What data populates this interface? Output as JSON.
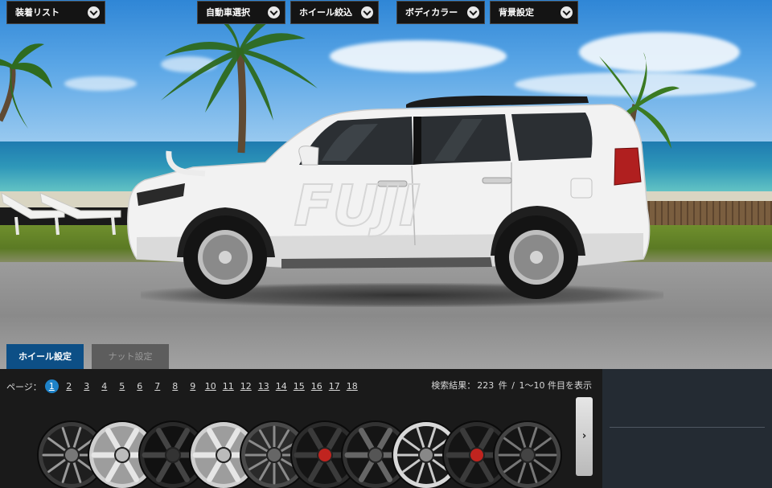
{
  "dropdowns": [
    {
      "label": "装着リスト"
    },
    {
      "label": "自動車選択"
    },
    {
      "label": "ホイール絞込"
    },
    {
      "label": "ボディカラー"
    },
    {
      "label": "背景設定"
    }
  ],
  "car": {
    "door_logo": "FUJI"
  },
  "tabs": [
    {
      "label": "ホイール設定",
      "active": true
    },
    {
      "label": "ナット設定",
      "active": false
    }
  ],
  "pager": {
    "label": "ページ：",
    "current": "1",
    "pages": [
      "2",
      "3",
      "4",
      "5",
      "6",
      "7",
      "8",
      "9",
      "10",
      "11",
      "12",
      "13",
      "14",
      "15",
      "16",
      "17",
      "18"
    ]
  },
  "result": {
    "label": "検索結果：",
    "count": "223",
    "unit": "件",
    "sep": "/",
    "range": "1〜10 件目を表示"
  },
  "wheels": [
    {
      "style": "multispoke-dark"
    },
    {
      "style": "six-spoke-silver"
    },
    {
      "style": "six-spoke-black"
    },
    {
      "style": "six-spoke-silver"
    },
    {
      "style": "multispoke-gunmetal"
    },
    {
      "style": "y-spoke-black-red"
    },
    {
      "style": "y-spoke-black"
    },
    {
      "style": "split-spoke-machined"
    },
    {
      "style": "y-spoke-black-red"
    },
    {
      "style": "split-spoke-black"
    }
  ],
  "next_button": {
    "label": "›"
  },
  "colors": {
    "accent": "#1e82c8",
    "tab_active": "#0d4f86",
    "panel": "#1a1a1a",
    "side_panel": "#242b33"
  }
}
